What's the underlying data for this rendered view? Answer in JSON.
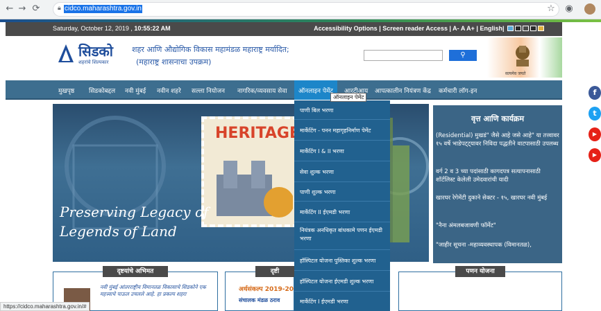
{
  "browser": {
    "url": "cidco.maharashtra.gov.in",
    "status_url": "https://cidco.maharashtra.gov.in/#"
  },
  "topbar": {
    "date": "Saturday, October 12, 2019 ,",
    "time": "10:55:22 AM",
    "accessibility": "Accessibility Options",
    "screen_reader": "Screen reader Access",
    "font_small": "A-",
    "font_normal": "A",
    "font_large": "A+",
    "language": "English",
    "theme_colors": [
      "#5aa9d6",
      "#2b2b2b",
      "#4a4a4a",
      "#2b2b2b",
      "#e0b040"
    ]
  },
  "header": {
    "logo_text": "सिडको",
    "logo_tagline": "शहरांचे शिल्पकार",
    "org_name": "शहर आणि औद्योगिक विकास महामंडळ महाराष्ट्र मर्यादित;",
    "org_sub": "(महाराष्ट्र शासनाचा उपक्रम)",
    "search_value": "",
    "search_icon": "search-icon",
    "emblem_caption": "सत्यमेव जयते"
  },
  "nav": {
    "items": [
      "मुखपृष्ठ",
      "सिडकोबद्दल",
      "नवी मुंबई",
      "नवीन शहरे",
      "सल्ला नियोजन",
      "नागरिक/व्यवसाय सेवा",
      "ऑनलाइन पेमेंट",
      "आरटीआय",
      "आपत्कालीन नियंत्रण केंद्र",
      "कर्मचारी लॉग-इन"
    ],
    "active_index": 6,
    "tooltip": "ऑनलाइन पेमेंट"
  },
  "dropdown": {
    "items": [
      "पाणी बिल भरणा",
      "मार्केटिंग - पनन महागृहनिर्माण पेमेंट",
      "मार्केटिंग I & II भरणा",
      "सेवा शुल्क भरणा",
      "पाणी शुल्क भरणा",
      "मार्केटिंग II ईएमडी भरणा",
      "नियंत्रक अनधिकृत बांधकामे पणन ईएमडी भरणा",
      "हॉस्पिटल योजना पुस्तिका शुल्क भरणा",
      "हॉस्पिटल योजना ईएमडी शुल्क भरणा",
      "मार्केटिंग I ईएमडी भरणा"
    ]
  },
  "hero": {
    "line1": "Preserving Legacy of",
    "line2": "Legends of Land",
    "stamp_text": "HERITAGE"
  },
  "news": {
    "title": "वृत्त आणि कार्यक्रम",
    "items": [
      "(Residential) मुखडं\" जैसे आहे जसे आहे\" या तत्त्वावर १५ वर्षे भाडेपट्ट्यावर निविदा पद्धतीने वाटपासाठी उपलब्ध",
      "वर्ग 2 व 3 च्या पदांसाठी कागदपत्र सत्यापनासाठी शॉर्टलिस्ट केलेली उमेदवारांची यादी",
      "खारघर रेगेमेंटी दुकाने सेक्टर - १५, खारघर नवी मुंबई",
      "\"नैना अंमलबजावणी फॉर्मेट\"",
      "\"जाहीर सूचना -महाव्यवस्थापक (विमानतळ),"
    ]
  },
  "bottom": {
    "vision_title": "दृष्टयांचे अभिमत",
    "vision_quote": "नवी मुंबई आंतरराष्ट्रीय विमानतळ विकासाचे सिडकोने एक महत्त्वाचे पाऊल उचलले आहे. हा प्रकल्प शहरा",
    "middle_title": "दृष्टी",
    "middle_line1": "अर्थसंकल्प 2019-20",
    "middle_line2": "संचालक मंडळ ठराव",
    "scheme_title": "पणन योजना"
  },
  "social": [
    "f",
    "t",
    "▶",
    "▶"
  ]
}
